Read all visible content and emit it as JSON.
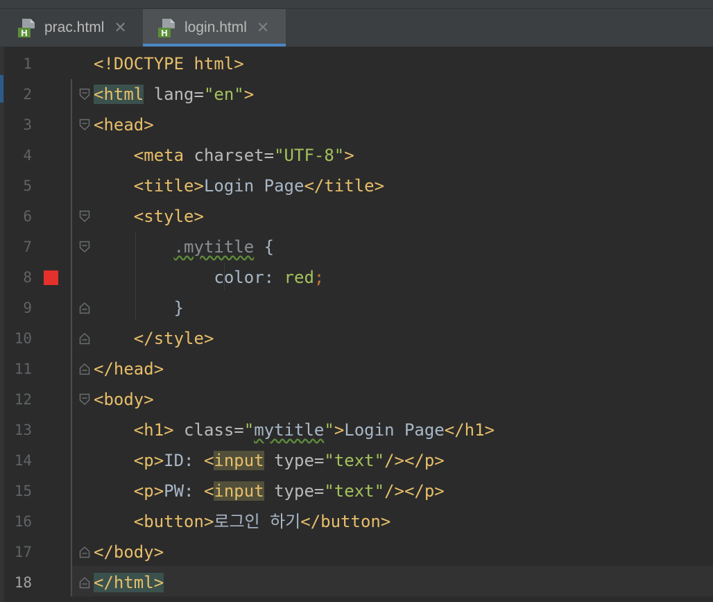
{
  "tabs": [
    {
      "label": "prac.html",
      "icon": "html-file-icon",
      "active": false
    },
    {
      "label": "login.html",
      "icon": "html-file-icon",
      "active": true
    }
  ],
  "lines": [
    {
      "n": "1",
      "segs": [
        [
          "tag",
          "<!DOCTYPE html>"
        ]
      ]
    },
    {
      "n": "2",
      "segs": [
        [
          "hl-tag",
          "<html"
        ],
        [
          "txt",
          " "
        ],
        [
          "attr",
          "lang="
        ],
        [
          "str",
          "\"en\""
        ],
        [
          "tag",
          ">"
        ]
      ]
    },
    {
      "n": "3",
      "segs": [
        [
          "tag",
          "<head>"
        ]
      ]
    },
    {
      "n": "4",
      "segs": [
        [
          "txt",
          "    "
        ],
        [
          "tag",
          "<meta"
        ],
        [
          "txt",
          " "
        ],
        [
          "attr",
          "charset="
        ],
        [
          "str",
          "\"UTF-8\""
        ],
        [
          "tag",
          ">"
        ]
      ]
    },
    {
      "n": "5",
      "segs": [
        [
          "txt",
          "    "
        ],
        [
          "tag",
          "<title>"
        ],
        [
          "txt",
          "Login Page"
        ],
        [
          "tag",
          "</title>"
        ]
      ]
    },
    {
      "n": "6",
      "segs": [
        [
          "txt",
          "    "
        ],
        [
          "tag",
          "<style>"
        ]
      ]
    },
    {
      "n": "7",
      "segs": [
        [
          "txt",
          "        "
        ],
        [
          "sel",
          ".mytitle"
        ],
        [
          "txt",
          " {"
        ]
      ]
    },
    {
      "n": "8",
      "segs": [
        [
          "txt",
          "            "
        ],
        [
          "ident",
          "color"
        ],
        [
          "txt",
          ": "
        ],
        [
          "str",
          "red"
        ],
        [
          "punct",
          ";"
        ]
      ]
    },
    {
      "n": "9",
      "segs": [
        [
          "txt",
          "        }"
        ]
      ]
    },
    {
      "n": "10",
      "segs": [
        [
          "txt",
          "    "
        ],
        [
          "tag",
          "</style>"
        ]
      ]
    },
    {
      "n": "11",
      "segs": [
        [
          "tag",
          "</head>"
        ]
      ]
    },
    {
      "n": "12",
      "segs": [
        [
          "tag",
          "<body>"
        ]
      ]
    },
    {
      "n": "13",
      "segs": [
        [
          "txt",
          "    "
        ],
        [
          "tag",
          "<h1>"
        ],
        [
          "txt",
          " "
        ],
        [
          "attr",
          "class="
        ],
        [
          "str",
          "\""
        ],
        [
          "bad",
          "mytitle"
        ],
        [
          "str",
          "\""
        ],
        [
          "tag",
          ">"
        ],
        [
          "txt",
          "Login Page"
        ],
        [
          "tag",
          "</h1>"
        ]
      ]
    },
    {
      "n": "14",
      "segs": [
        [
          "txt",
          "    "
        ],
        [
          "tag",
          "<p>"
        ],
        [
          "txt",
          "ID: "
        ],
        [
          "tag",
          "<"
        ],
        [
          "hl-warn",
          "input"
        ],
        [
          "txt",
          " "
        ],
        [
          "attr",
          "type="
        ],
        [
          "str",
          "\"text\""
        ],
        [
          "tag",
          "/></p>"
        ]
      ]
    },
    {
      "n": "15",
      "segs": [
        [
          "txt",
          "    "
        ],
        [
          "tag",
          "<p>"
        ],
        [
          "txt",
          "PW: "
        ],
        [
          "tag",
          "<"
        ],
        [
          "hl-warn",
          "input"
        ],
        [
          "txt",
          " "
        ],
        [
          "attr",
          "type="
        ],
        [
          "str",
          "\"text\""
        ],
        [
          "tag",
          "/></p>"
        ]
      ]
    },
    {
      "n": "16",
      "segs": [
        [
          "txt",
          "    "
        ],
        [
          "tag",
          "<button>"
        ],
        [
          "txt",
          "로그인 하기"
        ],
        [
          "tag",
          "</button>"
        ]
      ]
    },
    {
      "n": "17",
      "segs": [
        [
          "tag",
          "</body>"
        ]
      ]
    },
    {
      "n": "18",
      "segs": [
        [
          "hl-tag",
          "</html>"
        ]
      ]
    }
  ],
  "folds": {
    "2": "open",
    "3": "open",
    "6": "open",
    "7": "open",
    "9": "close",
    "10": "close",
    "11": "close",
    "12": "open",
    "17": "close",
    "18": "close"
  },
  "breakpoint_line": "8",
  "current_line": "18",
  "colors": {
    "breakpoint": "#e5312b",
    "active_tab_underline": "#4a88c7"
  }
}
